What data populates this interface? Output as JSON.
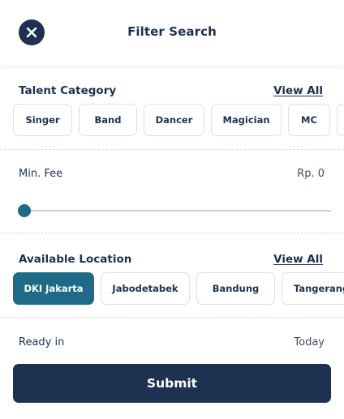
{
  "header": {
    "title": "Filter Search",
    "close_icon": "close-icon"
  },
  "talent_category": {
    "title": "Talent Category",
    "view_all": "View All",
    "chips": [
      {
        "label": "Singer",
        "selected": false
      },
      {
        "label": "Band",
        "selected": false
      },
      {
        "label": "Dancer",
        "selected": false
      },
      {
        "label": "Magician",
        "selected": false
      },
      {
        "label": "MC",
        "selected": false
      }
    ]
  },
  "min_fee": {
    "label": "Min. Fee",
    "value": "Rp. 0",
    "slider_fraction": 0
  },
  "available_location": {
    "title": "Available Location",
    "view_all": "View All",
    "chips": [
      {
        "label": "DKI Jakarta",
        "selected": true
      },
      {
        "label": "Jabodetabek",
        "selected": false
      },
      {
        "label": "Bandung",
        "selected": false
      },
      {
        "label": "Tangerang",
        "selected": false
      }
    ]
  },
  "ready_in": {
    "label": "Ready in",
    "value": "Today"
  },
  "submit_label": "Submit",
  "colors": {
    "primary": "#1d3250",
    "accent": "#1f6a86",
    "chip_border": "#dcdfe4"
  }
}
